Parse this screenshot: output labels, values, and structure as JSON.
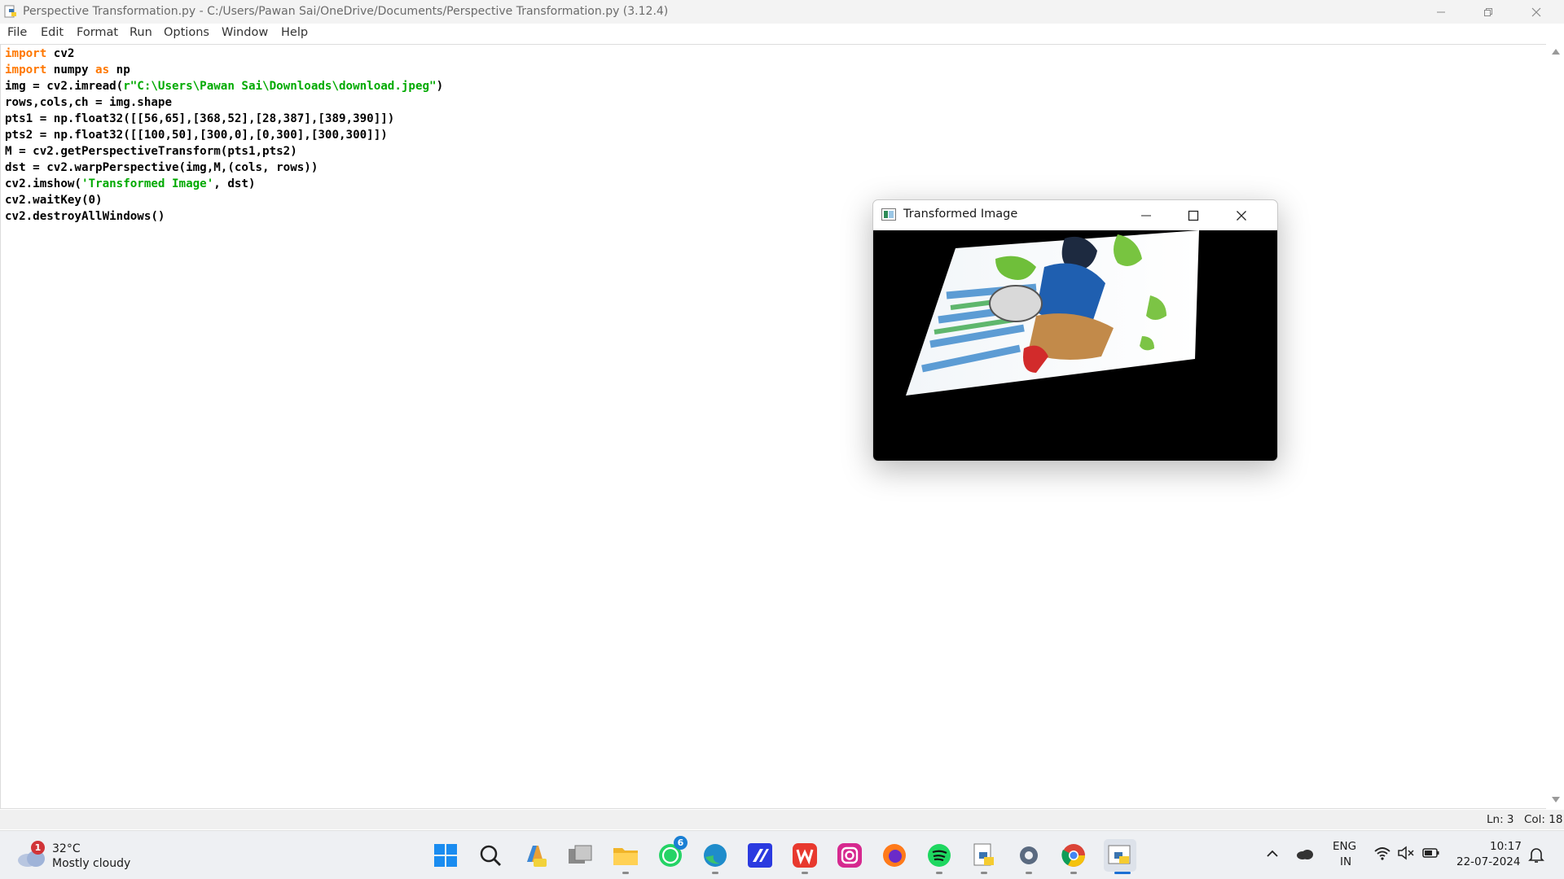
{
  "window": {
    "title": "Perspective Transformation.py - C:/Users/Pawan Sai/OneDrive/Documents/Perspective Transformation.py (3.12.4)"
  },
  "menu": [
    "File",
    "Edit",
    "Format",
    "Run",
    "Options",
    "Window",
    "Help"
  ],
  "code_lines": [
    {
      "tokens": [
        {
          "t": "kw",
          "v": "import"
        },
        {
          "t": "n",
          "v": " cv2"
        }
      ]
    },
    {
      "tokens": [
        {
          "t": "kw",
          "v": "import"
        },
        {
          "t": "n",
          "v": " numpy "
        },
        {
          "t": "kw",
          "v": "as"
        },
        {
          "t": "n",
          "v": " np"
        }
      ]
    },
    {
      "tokens": [
        {
          "t": "n",
          "v": "img = cv2.imread("
        },
        {
          "t": "str",
          "v": "r\"C:\\Users\\Pawan Sai\\Downloads\\download.jpeg\""
        },
        {
          "t": "n",
          "v": ")"
        }
      ]
    },
    {
      "tokens": [
        {
          "t": "n",
          "v": "rows,cols,ch = img.shape"
        }
      ]
    },
    {
      "tokens": [
        {
          "t": "n",
          "v": "pts1 = np.float32([[56,65],[368,52],[28,387],[389,390]])"
        }
      ]
    },
    {
      "tokens": [
        {
          "t": "n",
          "v": "pts2 = np.float32([[100,50],[300,0],[0,300],[300,300]])"
        }
      ]
    },
    {
      "tokens": [
        {
          "t": "n",
          "v": "M = cv2.getPerspectiveTransform(pts1,pts2)"
        }
      ]
    },
    {
      "tokens": [
        {
          "t": "n",
          "v": "dst = cv2.warpPerspective(img,M,(cols, rows))"
        }
      ]
    },
    {
      "tokens": [
        {
          "t": "n",
          "v": "cv2.imshow("
        },
        {
          "t": "str",
          "v": "'Transformed Image'"
        },
        {
          "t": "n",
          "v": ", dst)"
        }
      ]
    },
    {
      "tokens": [
        {
          "t": "n",
          "v": "cv2.waitKey(0)"
        }
      ]
    },
    {
      "tokens": [
        {
          "t": "n",
          "v": "cv2.destroyAllWindows()"
        }
      ]
    }
  ],
  "status": {
    "ln": "Ln: 3",
    "col": "Col: 18"
  },
  "image_window": {
    "title": "Transformed Image"
  },
  "taskbar": {
    "weather": {
      "temp": "32°C",
      "desc": "Mostly cloudy",
      "badge": "1"
    },
    "whatsapp_badge": "6",
    "lang": {
      "line1": "ENG",
      "line2": "IN"
    },
    "clock": {
      "time": "10:17",
      "date": "22-07-2024"
    },
    "apps": [
      "start-icon",
      "search-icon",
      "copilot-icon",
      "task-view-icon",
      "file-explorer-icon",
      "whatsapp-icon",
      "edge-icon",
      "app-icon",
      "wps-icon",
      "instagram-icon",
      "firefox-icon",
      "spotify-icon",
      "python-icon",
      "settings-icon",
      "chrome-icon",
      "idle-icon"
    ]
  },
  "colors": {
    "keyword": "#ff7700",
    "string": "#00aa00",
    "taskbar_bg": "#eef0f3"
  }
}
